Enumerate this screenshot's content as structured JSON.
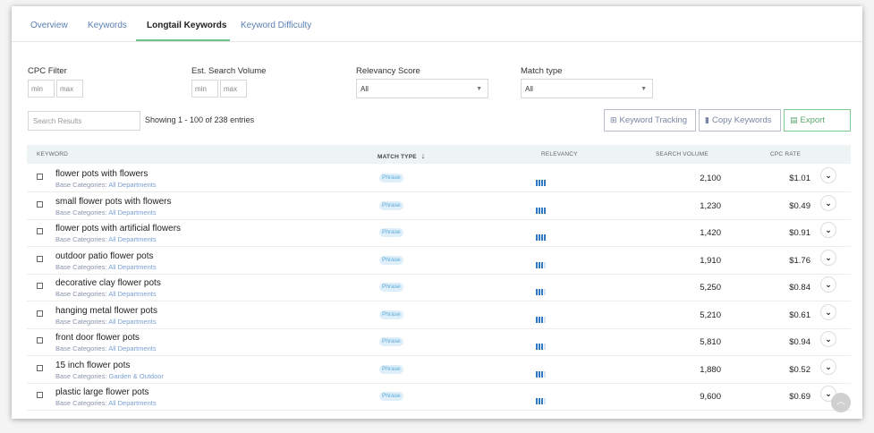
{
  "tabs": [
    {
      "label": "Overview"
    },
    {
      "label": "Keywords"
    },
    {
      "label": "Longtail Keywords"
    },
    {
      "label": "Keyword Difficulty"
    }
  ],
  "filters": {
    "cpc_label": "CPC Filter",
    "cpc_min": "min",
    "cpc_max": "max",
    "volume_label": "Est. Search Volume",
    "volume_min": "min",
    "volume_max": "max",
    "relevancy_label": "Relevancy Score",
    "relevancy_value": "All",
    "match_label": "Match type",
    "match_value": "All"
  },
  "toolbar": {
    "search_placeholder": "Search Results",
    "showing": "Showing 1 - 100 of 238 entries",
    "keyword_tracking": "Keyword Tracking",
    "copy_keywords": "Copy Keywords",
    "export": "Export"
  },
  "table": {
    "headers": {
      "keyword": "KEYWORD",
      "match_type": "MATCH TYPE",
      "relevancy": "RELEVANCY",
      "search_volume": "SEARCH VOLUME",
      "cpc_rate": "CPC RATE"
    },
    "category_label": "Base Categories:",
    "rows": [
      {
        "keyword": "flower pots with flowers",
        "category": "All Departments",
        "match": "Phrase",
        "relevancy": 4,
        "volume": "2,100",
        "cpc": "$1.01"
      },
      {
        "keyword": "small flower pots with flowers",
        "category": "All Departments",
        "match": "Phrase",
        "relevancy": 4,
        "volume": "1,230",
        "cpc": "$0.49"
      },
      {
        "keyword": "flower pots with artificial flowers",
        "category": "All Departments",
        "match": "Phrase",
        "relevancy": 4,
        "volume": "1,420",
        "cpc": "$0.91"
      },
      {
        "keyword": "outdoor patio flower pots",
        "category": "All Departments",
        "match": "Phrase",
        "relevancy": 3,
        "volume": "1,910",
        "cpc": "$1.76"
      },
      {
        "keyword": "decorative clay flower pots",
        "category": "All Departments",
        "match": "Phrase",
        "relevancy": 3,
        "volume": "5,250",
        "cpc": "$0.84"
      },
      {
        "keyword": "hanging metal flower pots",
        "category": "All Departments",
        "match": "Phrase",
        "relevancy": 3,
        "volume": "5,210",
        "cpc": "$0.61"
      },
      {
        "keyword": "front door flower pots",
        "category": "All Departments",
        "match": "Phrase",
        "relevancy": 3,
        "volume": "5,810",
        "cpc": "$0.94"
      },
      {
        "keyword": "15 inch flower pots",
        "category": "Garden & Outdoor",
        "match": "Phrase",
        "relevancy": 3,
        "volume": "1,880",
        "cpc": "$0.52"
      },
      {
        "keyword": "plastic large flower pots",
        "category": "All Departments",
        "match": "Phrase",
        "relevancy": 3,
        "volume": "9,600",
        "cpc": "$0.69"
      }
    ]
  }
}
